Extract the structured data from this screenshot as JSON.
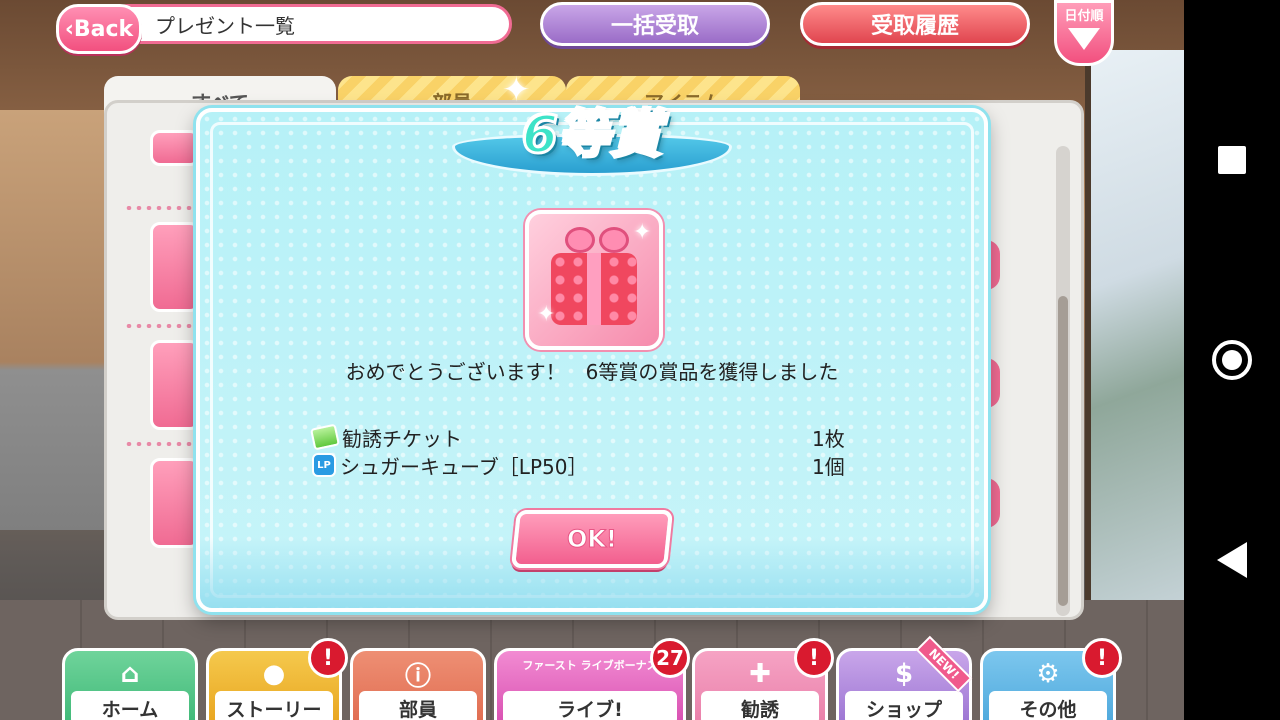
{
  "header": {
    "back_label": "Back",
    "title": "プレゼント一覧",
    "receive_all_label": "一括受取",
    "history_label": "受取履歴",
    "sort_label": "日付順"
  },
  "tabs": [
    {
      "label": "すべて"
    },
    {
      "label": "部員"
    },
    {
      "label": "アイテム"
    }
  ],
  "modal": {
    "title": "6等賞",
    "message": "おめでとうございます！　6等賞の賞品を獲得しました",
    "prizes": [
      {
        "name": "勧誘チケット",
        "qty": "1枚",
        "icon": "ticket-icon"
      },
      {
        "name": "シュガーキューブ［LP50］",
        "qty": "1個",
        "icon": "lp-icon",
        "icon_text": "LP"
      }
    ],
    "ok_label": "OK!"
  },
  "bottom_nav": [
    {
      "label": "ホーム",
      "icon": "home-icon"
    },
    {
      "label": "ストーリー",
      "icon": "chat-icon",
      "badge": "!"
    },
    {
      "label": "部員",
      "icon": "member-icon"
    },
    {
      "label": "ライブ!",
      "icon": "live-icon",
      "sub_label": "ファースト ライブボーナス",
      "badge": "27"
    },
    {
      "label": "勧誘",
      "icon": "scout-icon",
      "badge": "!"
    },
    {
      "label": "ショップ",
      "icon": "shop-icon",
      "ribbon": "NEW!"
    },
    {
      "label": "その他",
      "icon": "gear-icon",
      "badge": "!"
    }
  ],
  "colors": {
    "modal_bg": "#b6f1f7",
    "accent_pink": "#f25f8e",
    "badge_red": "#d91a2f"
  }
}
